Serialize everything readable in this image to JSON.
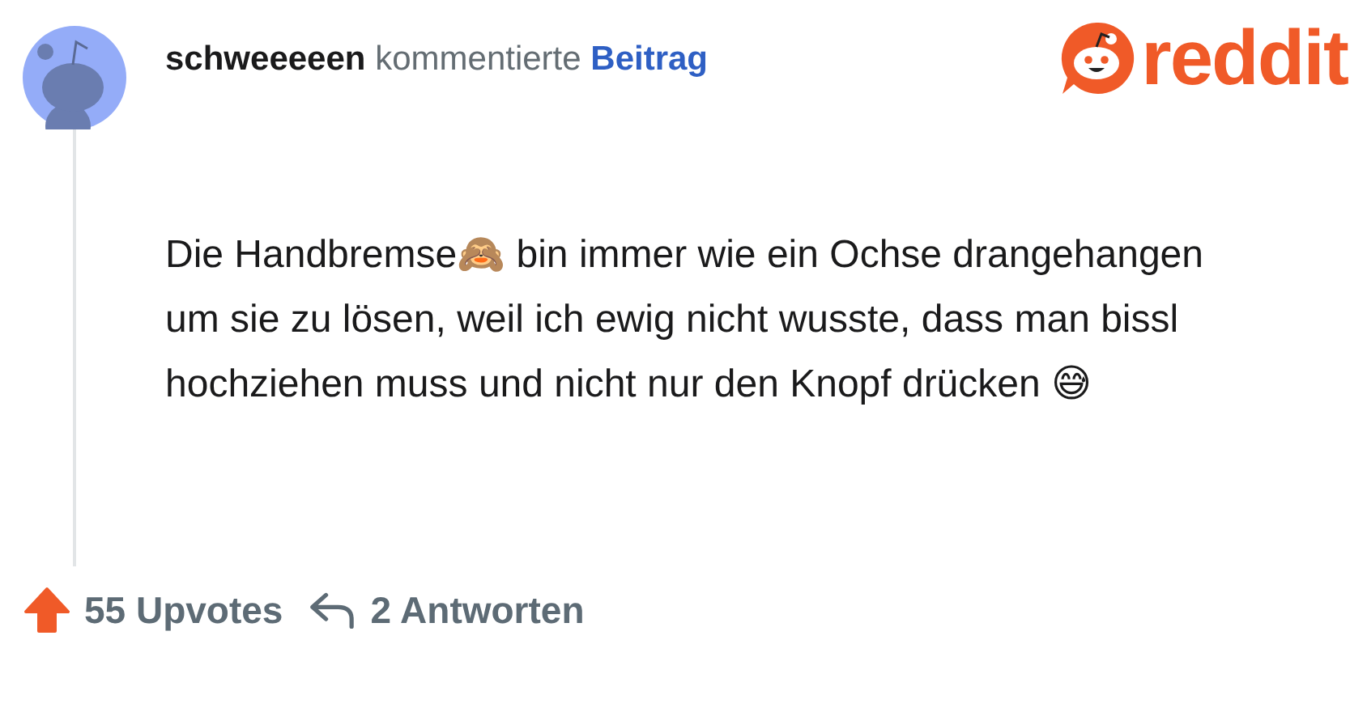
{
  "comment": {
    "author": "schweeeeen",
    "action": "kommentierte",
    "target": "Beitrag",
    "body": "Die Handbremse🙈 bin immer wie ein Ochse drangehangen um sie zu lösen, weil ich ewig nicht wusste, dass man bissl hochziehen muss und nicht nur den Knopf drücken 😅"
  },
  "logo": {
    "text": "reddit"
  },
  "footer": {
    "upvoted": true,
    "upvotes": "55 Upvotes",
    "replies": "2 Antworten"
  }
}
